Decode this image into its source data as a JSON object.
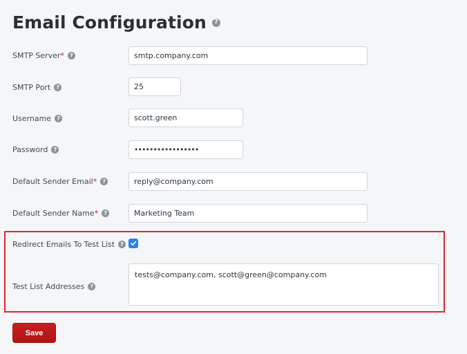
{
  "title": "Email Configuration",
  "help_glyph": "?",
  "fields": {
    "smtp_server": {
      "label": "SMTP Server",
      "required_mark": "*",
      "value": "smtp.company.com"
    },
    "smtp_port": {
      "label": "SMTP Port",
      "value": "25"
    },
    "username": {
      "label": "Username",
      "value": "scott.green"
    },
    "password": {
      "label": "Password",
      "value": "•••••••••••••••••"
    },
    "default_sender_email": {
      "label": "Default Sender Email",
      "required_mark": "*",
      "value": "reply@company.com"
    },
    "default_sender_name": {
      "label": "Default Sender Name",
      "required_mark": "*",
      "value": "Marketing Team"
    },
    "redirect_to_test_list": {
      "label": "Redirect Emails To Test List",
      "checked": true
    },
    "test_list_addresses": {
      "label": "Test List Addresses",
      "value": "tests@company.com, scott@green@company.com"
    }
  },
  "buttons": {
    "save_label": "Save"
  },
  "colors": {
    "accent": "#2f80ed",
    "save_button": "#b81919",
    "highlight": "#e0262f",
    "required": "#c81c1c"
  },
  "icons": {
    "help": "question-circle-icon",
    "check": "check-icon"
  }
}
